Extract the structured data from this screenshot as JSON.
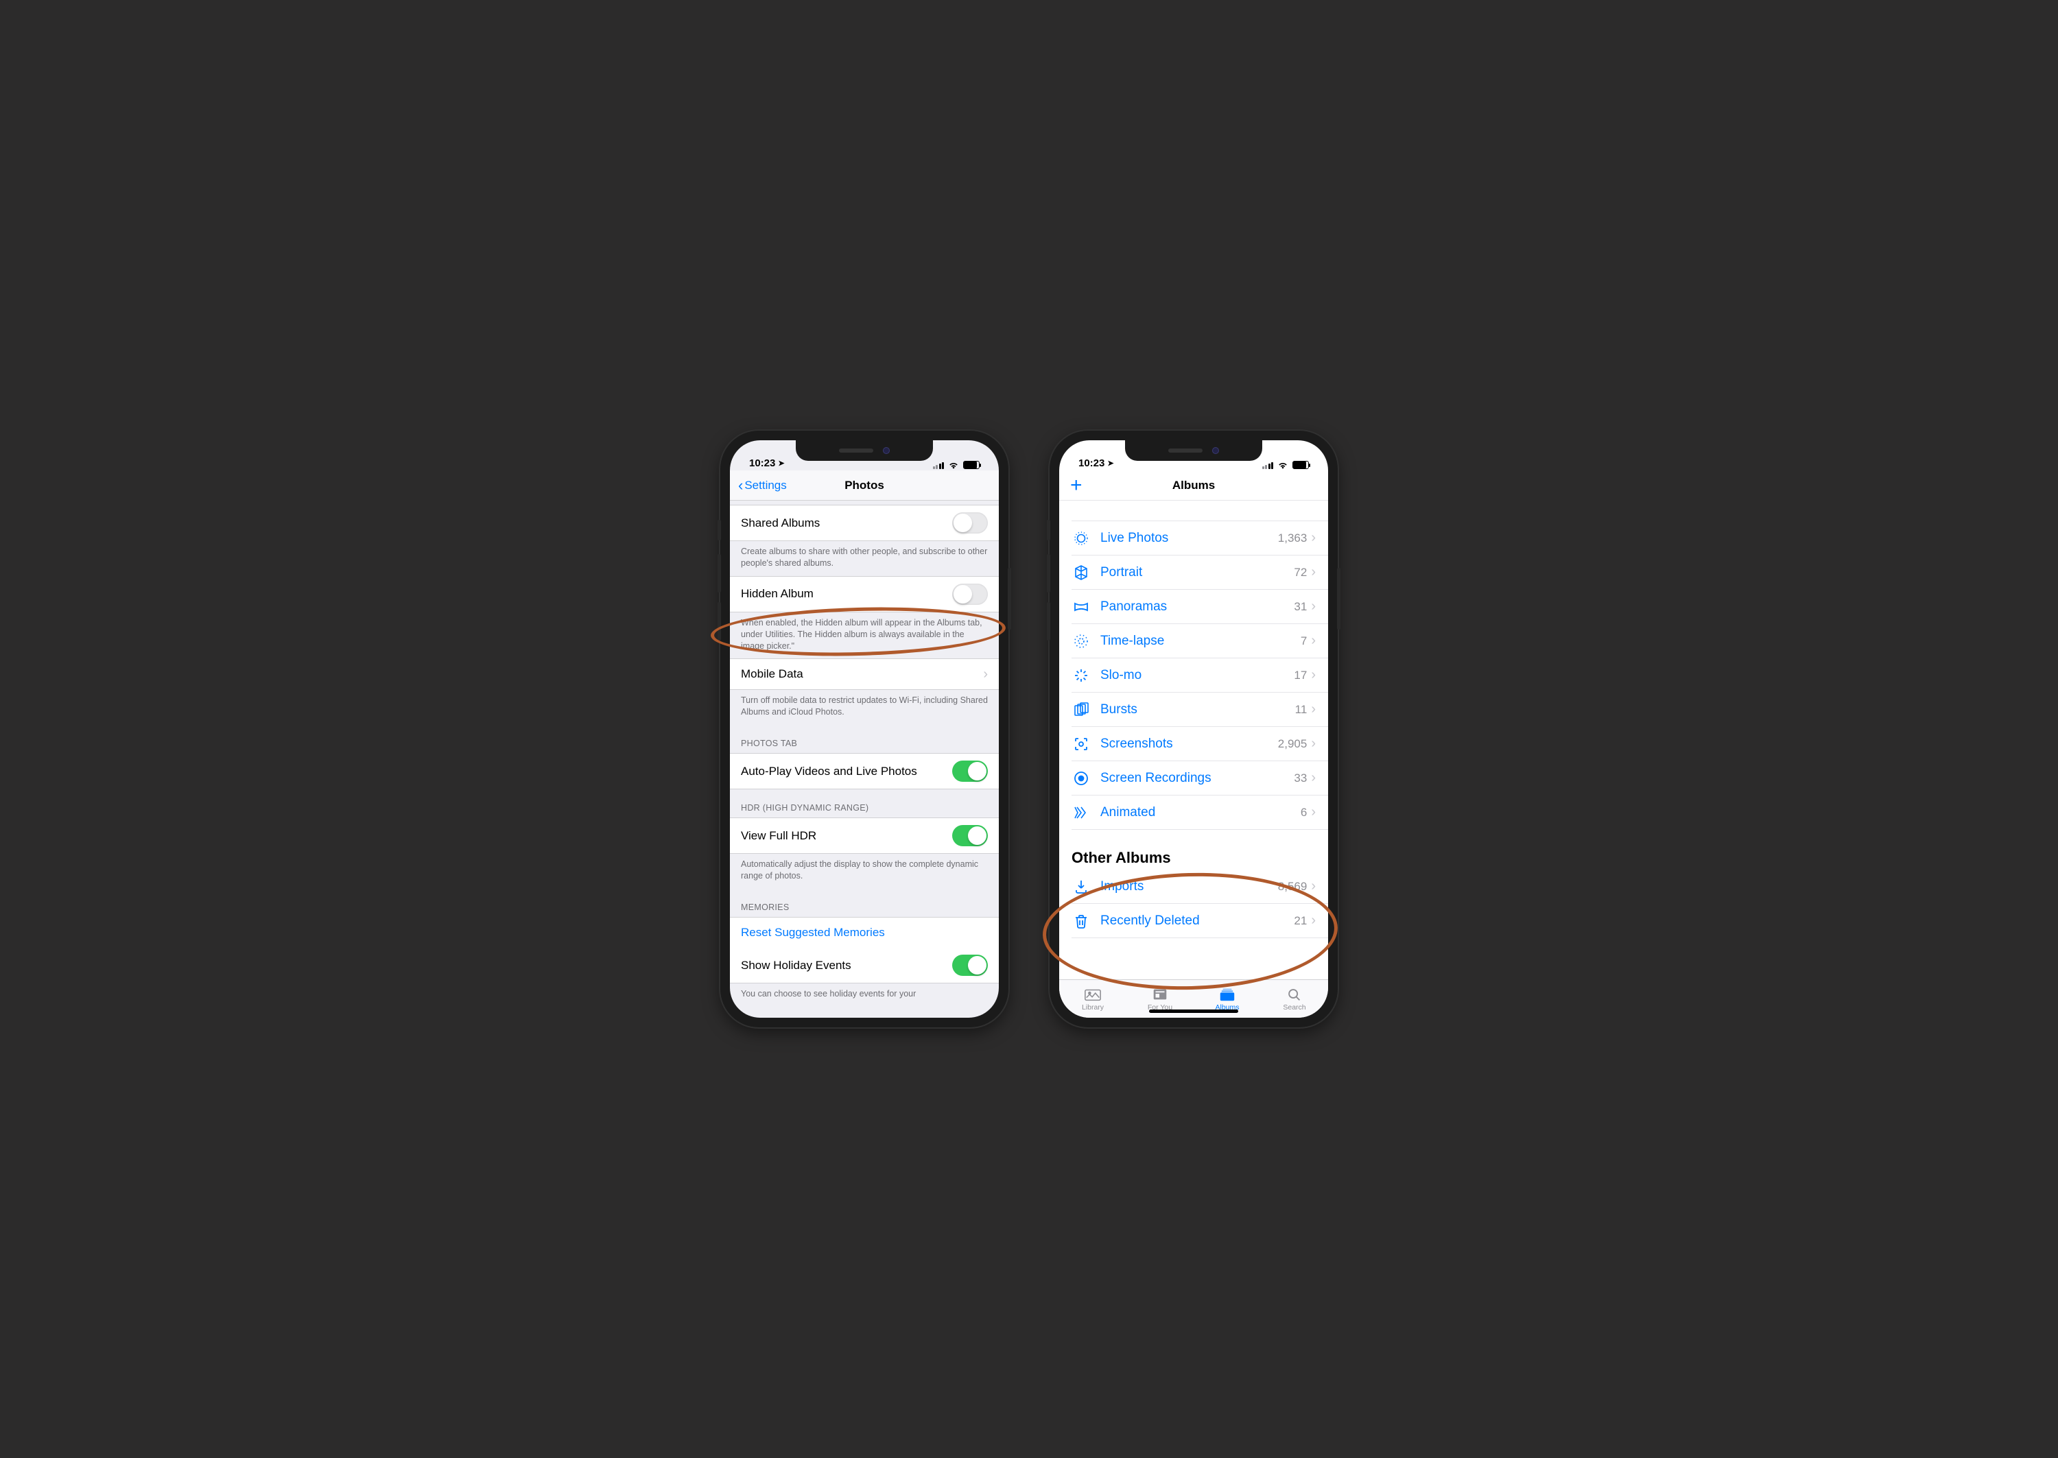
{
  "status": {
    "time": "10:23"
  },
  "phone1": {
    "nav": {
      "back": "Settings",
      "title": "Photos"
    },
    "shared": {
      "label": "Shared Albums",
      "footer": "Create albums to share with other people, and subscribe to other people's shared albums."
    },
    "hidden": {
      "label": "Hidden Album",
      "footer": "When enabled, the Hidden album will appear in the Albums tab, under Utilities. The Hidden album is always available in the image picker.\""
    },
    "mobile": {
      "label": "Mobile Data",
      "footer": "Turn off mobile data to restrict updates to Wi-Fi, including Shared Albums and iCloud Photos."
    },
    "photos_tab": {
      "header": "PHOTOS TAB",
      "autoplay": "Auto-Play Videos and Live Photos"
    },
    "hdr": {
      "header": "HDR (HIGH DYNAMIC RANGE)",
      "label": "View Full HDR",
      "footer": "Automatically adjust the display to show the complete dynamic range of photos."
    },
    "memories": {
      "header": "MEMORIES",
      "reset": "Reset Suggested Memories",
      "holiday": "Show Holiday Events",
      "footer": "You can choose to see holiday events for your"
    }
  },
  "phone2": {
    "nav": {
      "title": "Albums"
    },
    "albums": [
      {
        "icon": "live-photos-icon",
        "title": "Live Photos",
        "count": "1,363"
      },
      {
        "icon": "portrait-icon",
        "title": "Portrait",
        "count": "72"
      },
      {
        "icon": "panoramas-icon",
        "title": "Panoramas",
        "count": "31"
      },
      {
        "icon": "timelapse-icon",
        "title": "Time-lapse",
        "count": "7"
      },
      {
        "icon": "slomo-icon",
        "title": "Slo-mo",
        "count": "17"
      },
      {
        "icon": "bursts-icon",
        "title": "Bursts",
        "count": "11"
      },
      {
        "icon": "screenshots-icon",
        "title": "Screenshots",
        "count": "2,905"
      },
      {
        "icon": "screen-recordings-icon",
        "title": "Screen Recordings",
        "count": "33"
      },
      {
        "icon": "animated-icon",
        "title": "Animated",
        "count": "6"
      }
    ],
    "other_header": "Other Albums",
    "other": [
      {
        "icon": "imports-icon",
        "title": "Imports",
        "count": "8,569"
      },
      {
        "icon": "recently-deleted-icon",
        "title": "Recently Deleted",
        "count": "21"
      }
    ],
    "tabs": {
      "library": "Library",
      "foryou": "For You",
      "albums": "Albums",
      "search": "Search"
    }
  }
}
